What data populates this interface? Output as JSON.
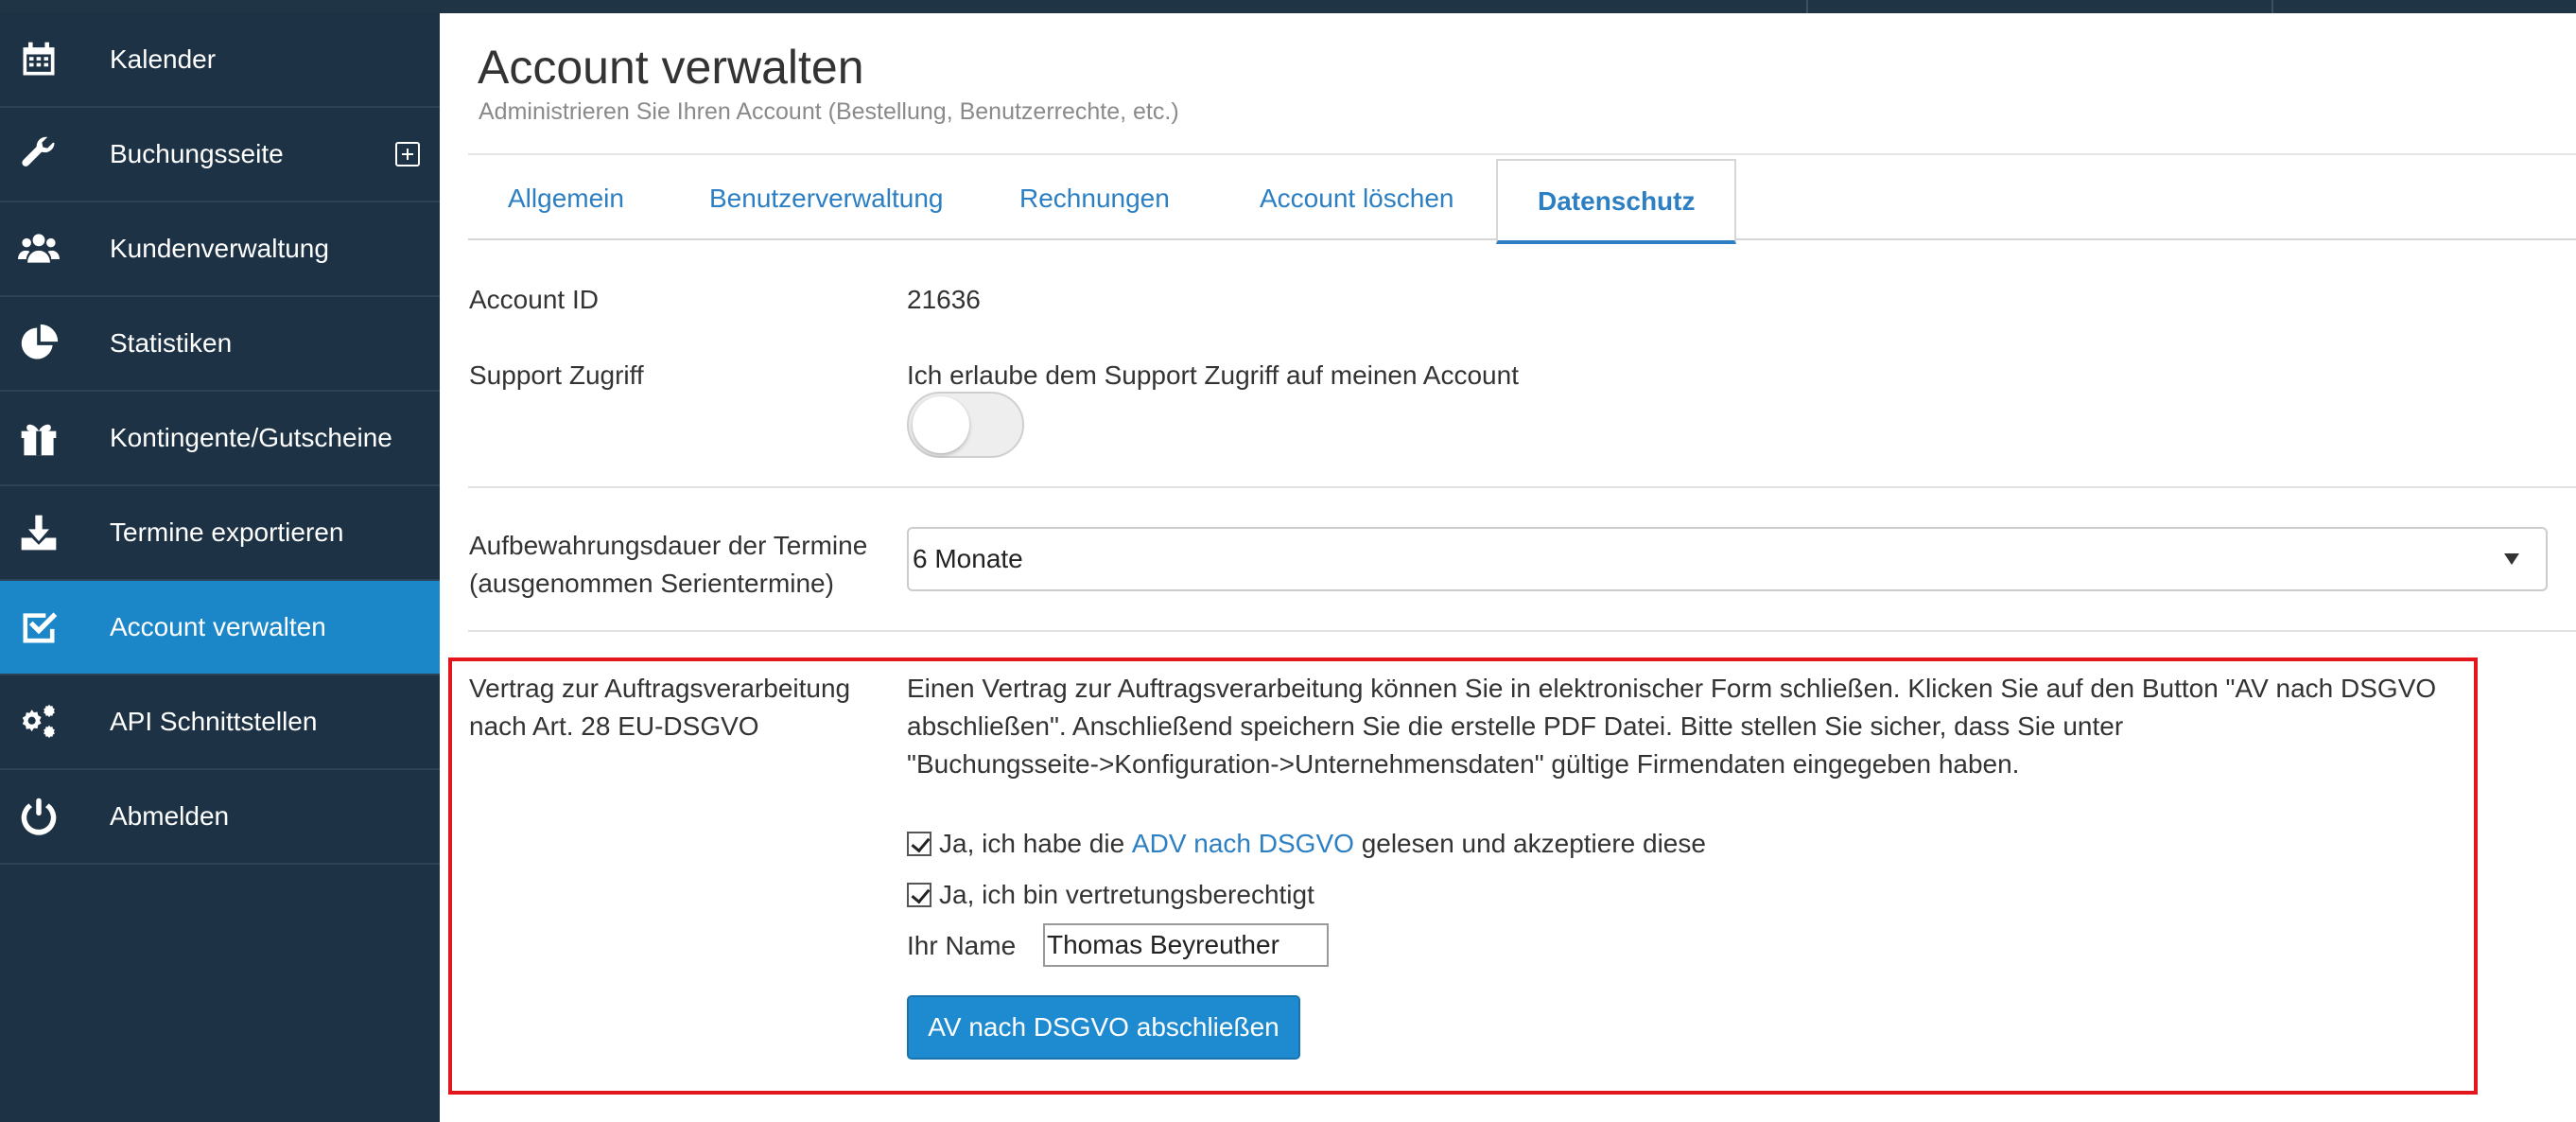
{
  "sidebar": {
    "items": [
      {
        "label": "Kalender",
        "icon": "calendar-icon"
      },
      {
        "label": "Buchungsseite",
        "icon": "wrench-icon",
        "expand_icon": "plus-square-icon"
      },
      {
        "label": "Kundenverwaltung",
        "icon": "users-icon"
      },
      {
        "label": "Statistiken",
        "icon": "pie-chart-icon"
      },
      {
        "label": "Kontingente/Gutscheine",
        "icon": "gift-icon"
      },
      {
        "label": "Termine exportieren",
        "icon": "download-icon"
      },
      {
        "label": "Account verwalten",
        "icon": "check-square-icon",
        "active": true
      },
      {
        "label": "API Schnittstellen",
        "icon": "gears-icon"
      },
      {
        "label": "Abmelden",
        "icon": "power-icon"
      }
    ]
  },
  "header": {
    "title": "Account verwalten",
    "subtitle": "Administrieren Sie Ihren Account (Bestellung, Benutzerrechte, etc.)"
  },
  "tabs": [
    {
      "label": "Allgemein"
    },
    {
      "label": "Benutzerverwaltung"
    },
    {
      "label": "Rechnungen"
    },
    {
      "label": "Account löschen"
    },
    {
      "label": "Datenschutz",
      "active": true
    }
  ],
  "form": {
    "account_id": {
      "label": "Account ID",
      "value": "21636"
    },
    "support": {
      "label": "Support Zugriff",
      "text": "Ich erlaube dem Support Zugriff auf meinen Account",
      "enabled": false
    },
    "retention": {
      "label_line1": "Aufbewahrungsdauer der Termine",
      "label_line2": "(ausgenommen Serientermine)",
      "value": "6 Monate"
    },
    "av": {
      "label_line1": "Vertrag zur Auftragsverarbeitung",
      "label_line2": "nach Art. 28 EU-DSGVO",
      "description_line1": "Einen Vertrag zur Auftragsverarbeitung können Sie in elektronischer Form schließen. Klicken Sie auf den Button \"AV nach DSGVO",
      "description_line2": "abschließen\". Anschließend speichern Sie die erstelle PDF Datei. Bitte stellen Sie sicher, dass Sie unter",
      "description_line3": "\"Buchungsseite->Konfiguration->Unternehmensdaten\" gültige Firmendaten eingegeben haben.",
      "checkbox1_prefix": "Ja, ich habe die",
      "checkbox1_link": "ADV nach DSGVO",
      "checkbox1_suffix": "gelesen und akzeptiere diese",
      "checkbox1_checked": true,
      "checkbox2_label": "Ja, ich bin vertretungsberechtigt",
      "checkbox2_checked": true,
      "name_label": "Ihr Name",
      "name_value": "Thomas Beyreuther",
      "submit_label": "AV nach DSGVO abschließen"
    }
  },
  "colors": {
    "sidebar_bg": "#1d3244",
    "active_nav": "#1b87c9",
    "link": "#2b7fc2",
    "highlight_border": "#e3161e",
    "primary_button": "#1e8bd0"
  }
}
